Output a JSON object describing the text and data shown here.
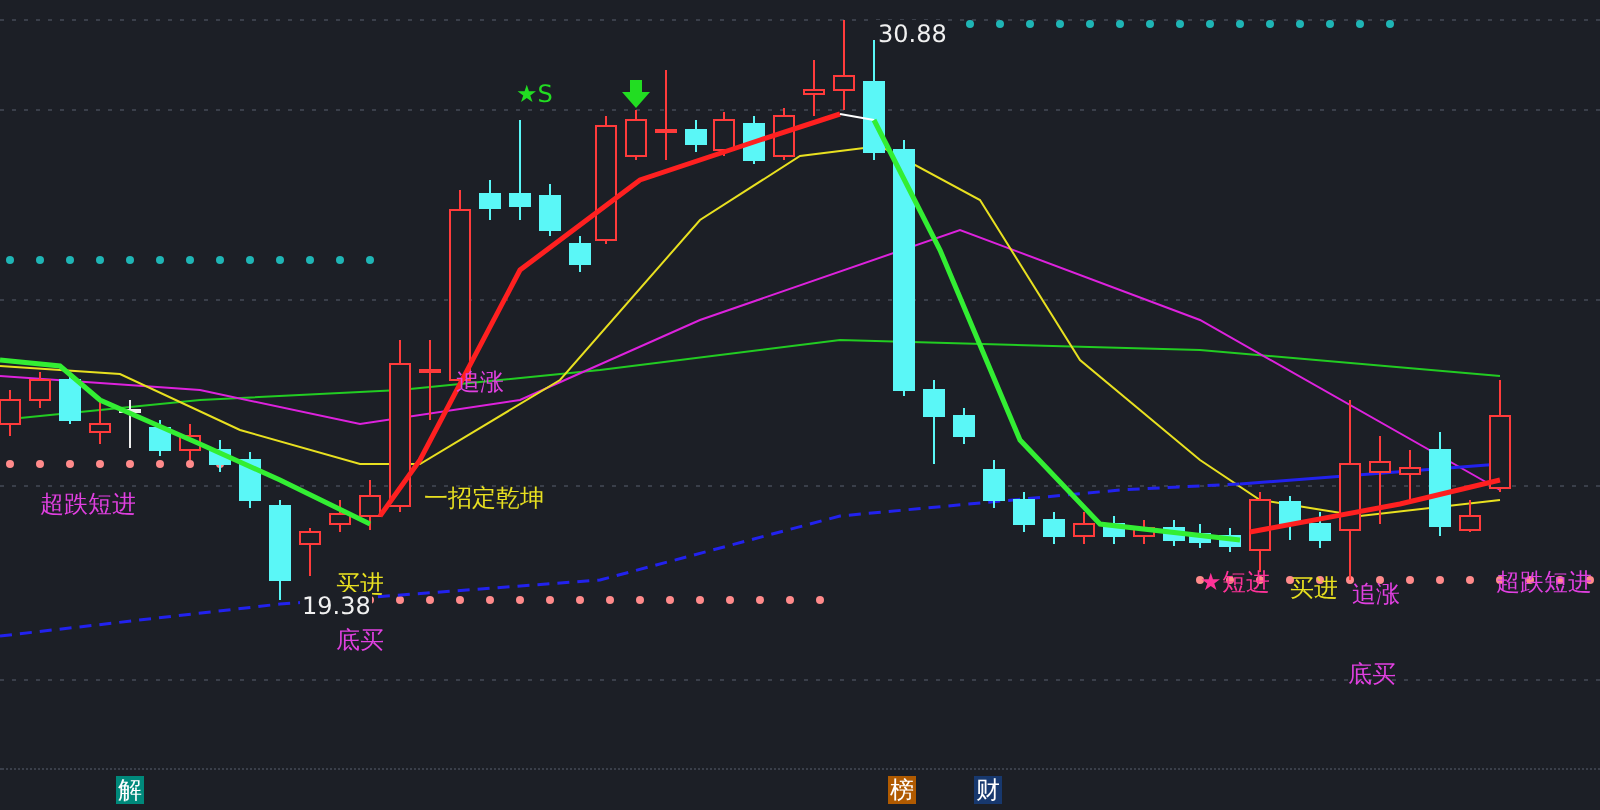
{
  "chart": {
    "price_marks": [
      {
        "text": "30.88",
        "kind": "high"
      },
      {
        "text": "19.38",
        "kind": "low"
      }
    ],
    "labels": [
      {
        "text": "★S",
        "color": "#22dd22"
      },
      {
        "text": "追涨",
        "color": "#e040e0"
      },
      {
        "text": "超跌短进",
        "color": "#e040e0"
      },
      {
        "text": "一招定乾坤",
        "color": "#e8e020"
      },
      {
        "text": "买进",
        "color": "#e8e020"
      },
      {
        "text": "底买",
        "color": "#e040e0"
      },
      {
        "text": "★短进",
        "color": "#ff3399"
      },
      {
        "text": "买进",
        "color": "#e8e020"
      },
      {
        "text": "追涨",
        "color": "#e040e0"
      },
      {
        "text": "超跌短进",
        "color": "#e040e0"
      },
      {
        "text": "底买",
        "color": "#e040e0"
      }
    ]
  },
  "bottom_badges": [
    {
      "text": "解",
      "color": "#00897b"
    },
    {
      "text": "榜",
      "color": "#b05a00"
    },
    {
      "text": "财",
      "color": "#17386e"
    }
  ]
}
